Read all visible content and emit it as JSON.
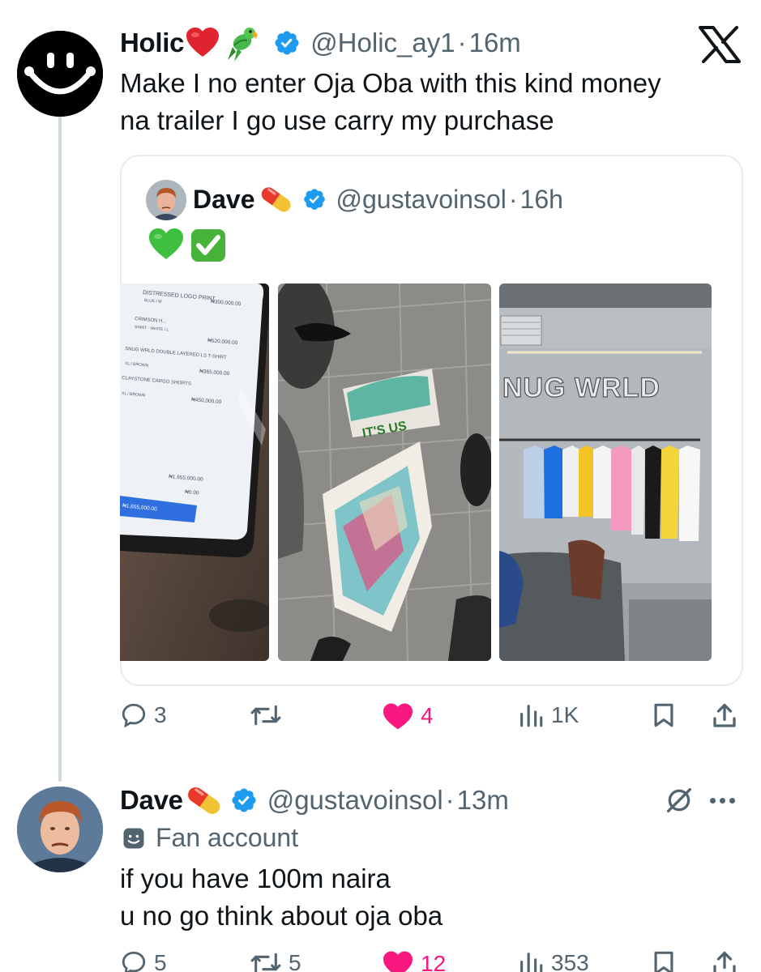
{
  "tweet": {
    "author_name": "Holic",
    "name_emojis": [
      "red-heart",
      "parrot"
    ],
    "handle": "@Holic_ay1",
    "separator": "·",
    "time": "16m",
    "text": "Make I no enter Oja Oba with this kind money\nna  trailer I go use  carry my purchase",
    "quote": {
      "author_name": "Dave",
      "name_emoji": "pill",
      "handle": "@gustavoinsol",
      "time": "16h",
      "emojis": [
        "green-heart",
        "check-mark-button"
      ],
      "photos": [
        {
          "kind": "tablet-receipt",
          "lines": [
            {
              "item": "DISTRESSED LOGO PRINT",
              "sub": "BLUE / M",
              "price": "₦300,000.00"
            },
            {
              "item": "CRIMSON H...",
              "sub": "SHIRT · WHITE / L",
              "price": "₦520,000.00"
            },
            {
              "item": "SNUG WRLD DOUBLE LAYERED LS T-SHIRT",
              "sub": "XL / BROWN",
              "price": "₦385,000.00"
            },
            {
              "item": "CLAYSTONE CARGO SHORTS",
              "sub": "XL / BROWN",
              "price": "₦450,000.00"
            }
          ],
          "subtotal": "₦1,655,000.00",
          "zero": "₦0.00",
          "pay_button": "₦1,655,000.00"
        },
        {
          "kind": "shopping-bags",
          "bag_text": "IT'S US"
        },
        {
          "kind": "store-display",
          "sign": "NUG WRLD"
        }
      ]
    },
    "actions": {
      "replies": "3",
      "reposts": "",
      "likes": "4",
      "views": "1K"
    }
  },
  "reply": {
    "author_name": "Dave",
    "name_emoji": "pill",
    "handle": "@gustavoinsol",
    "time": "13m",
    "label": "Fan account",
    "text": "if you have 100m naira\nu no go think about oja oba",
    "actions": {
      "replies": "5",
      "reposts": "5",
      "likes": "12",
      "views": "353"
    }
  },
  "colors": {
    "accent": "#1d9bf0",
    "like": "#f91880",
    "muted": "#536471",
    "text": "#0f1419"
  }
}
